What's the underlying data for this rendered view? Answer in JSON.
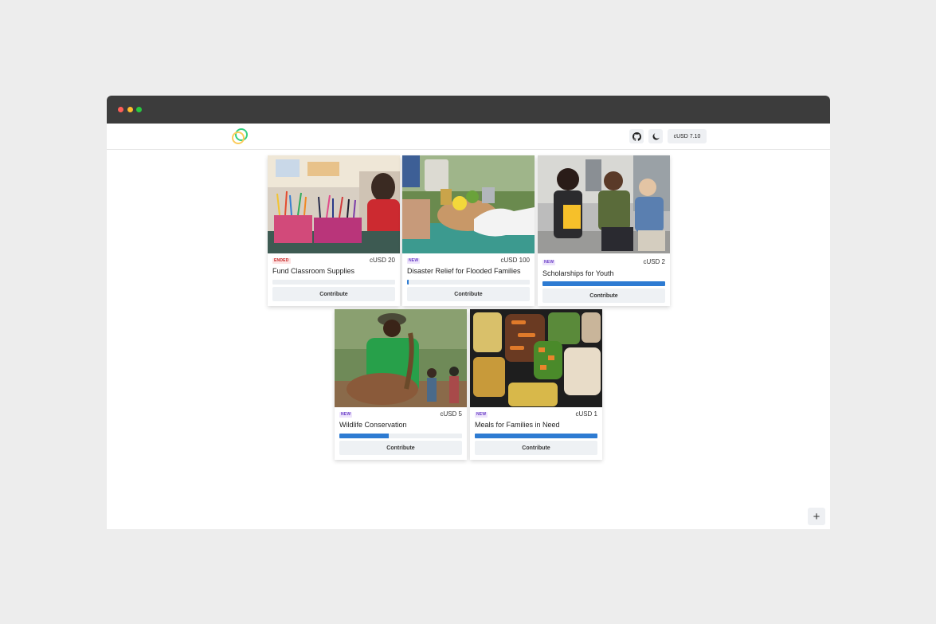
{
  "navbar": {
    "logo": "app-logo",
    "github_icon": "github-icon",
    "theme_icon": "moon-icon",
    "balance": "cUSD 7.10"
  },
  "campaigns": [
    {
      "title": "Fund Classroom Supplies",
      "badge": "ENDED",
      "amount": "cUSD 20",
      "progress": 0.0,
      "button": "Contribute",
      "image": "classroom-supplies-photo"
    },
    {
      "title": "Disaster Relief for Flooded Families",
      "badge": "NEW",
      "amount": "cUSD 100",
      "progress": 0.01,
      "button": "Contribute",
      "image": "food-donation-photo"
    },
    {
      "title": "Scholarships for Youth",
      "badge": "NEW",
      "amount": "cUSD 2",
      "progress": 1.0,
      "button": "Contribute",
      "image": "students-photo"
    },
    {
      "title": "Wildlife Conservation",
      "badge": "NEW",
      "amount": "cUSD 5",
      "progress": 0.4,
      "button": "Contribute",
      "image": "wildlife-ranger-photo"
    },
    {
      "title": "Meals for Families in Need",
      "badge": "NEW",
      "amount": "cUSD 1",
      "progress": 1.0,
      "button": "Contribute",
      "image": "meal-containers-photo"
    }
  ],
  "fab": {
    "label": "+",
    "icon": "plus-icon"
  },
  "colors": {
    "accent": "#2d7bd2",
    "ended_badge": "#c62828",
    "new_badge": "#6b3fc7",
    "titlebar": "#3c3c3c"
  }
}
